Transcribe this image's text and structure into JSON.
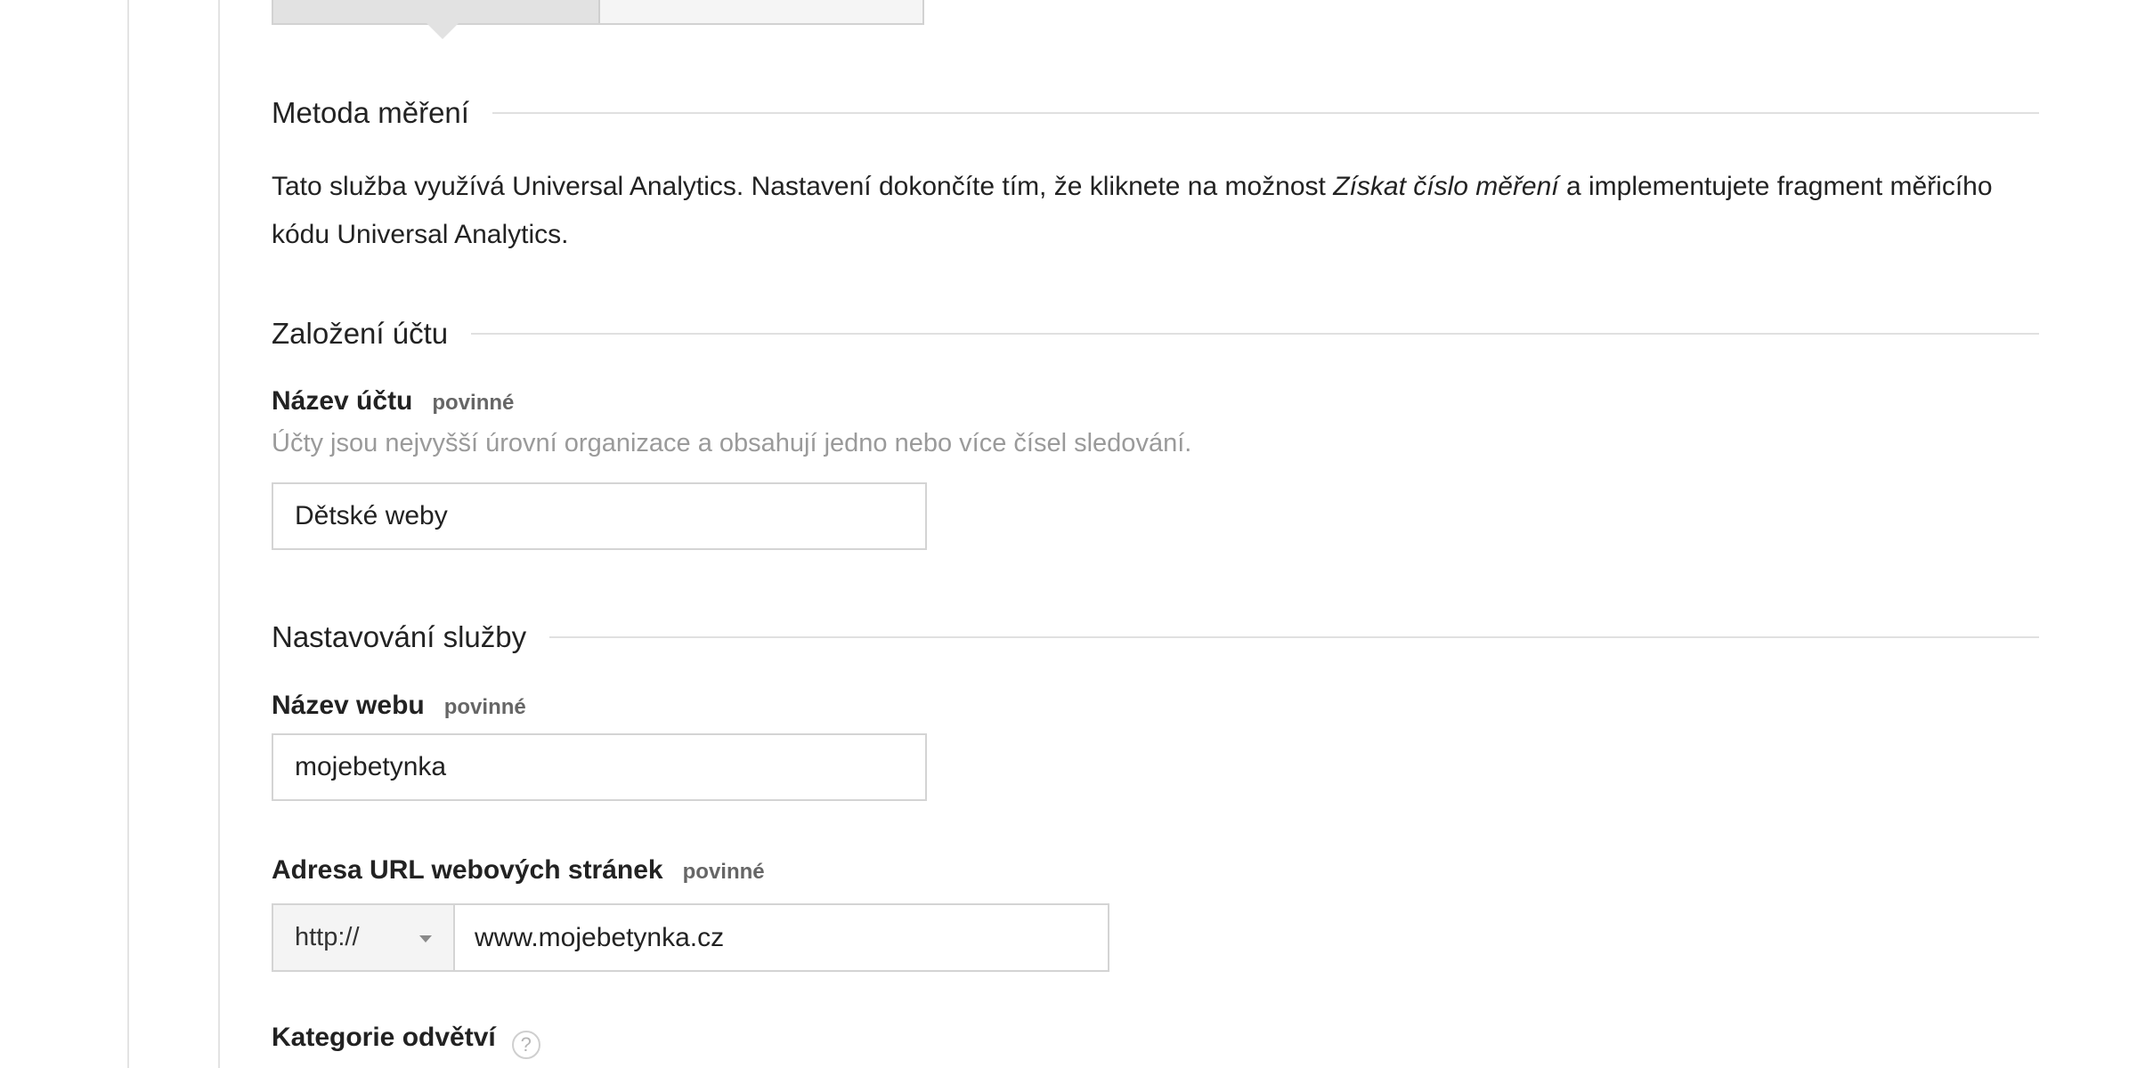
{
  "measurement": {
    "title": "Metoda měření",
    "desc_before": "Tato služba využívá Universal Analytics. Nastavení dokončíte tím, že kliknete na možnost ",
    "desc_link": "Získat číslo měření",
    "desc_after": " a implementujete fragment měřicího kódu Universal Analytics."
  },
  "account": {
    "title": "Založení účtu",
    "name_label": "Název účtu",
    "required": "povinné",
    "hint": "Účty jsou nejvyšší úrovní organizace a obsahují jedno nebo více čísel sledování.",
    "name_value": "Dětské weby"
  },
  "property": {
    "title": "Nastavování služby",
    "site_label": "Název webu",
    "required": "povinné",
    "site_value": "mojebetynka",
    "url_label": "Adresa URL webových stránek",
    "protocol": "http://",
    "url_value": "www.mojebetynka.cz",
    "category_label": "Kategorie odvětví",
    "help_icon": "?"
  }
}
